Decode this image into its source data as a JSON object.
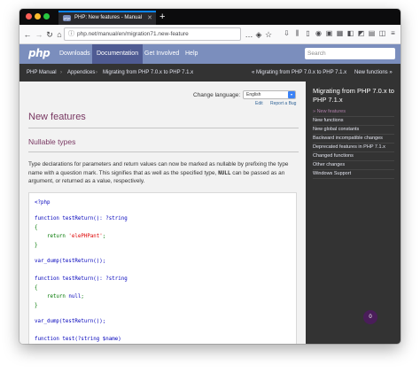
{
  "tab": {
    "title": "PHP: New features - Manual",
    "favicon_text": "php"
  },
  "nav": {
    "url": "php.net/manual/en/migration71.new-feature"
  },
  "site": {
    "logo": "php",
    "menu": [
      {
        "label": "Downloads",
        "active": false
      },
      {
        "label": "Documentation",
        "active": true
      },
      {
        "label": "Get Involved",
        "active": false
      },
      {
        "label": "Help",
        "active": false
      }
    ],
    "search_placeholder": "Search"
  },
  "breadcrumb": {
    "items": [
      "PHP Manual",
      "Appendices",
      "Migrating from PHP 7.0.x to PHP 7.1.x"
    ],
    "separator": "›",
    "prev": "« Migrating from PHP 7.0.x to PHP 7.1.x",
    "next": "New functions »"
  },
  "main": {
    "change_language_label": "Change language:",
    "language_value": "English",
    "edit_link": "Edit",
    "report_bug_link": "Report a Bug",
    "title": "New features",
    "section_title": "Nullable types",
    "para_before": "Type declarations for parameters and return values can now be marked as nullable by prefixing the type name with a question mark. This signifies that as well as the specified type,",
    "para_null": "NULL",
    "para_after": "can be passed as an argument, or returned as a value, respectively.",
    "code": {
      "l1": "<?php",
      "l2": "function testReturn(): ?string",
      "l3": "{",
      "l4a": "    return ",
      "l4b": "'elePHPant'",
      "l4c": ";",
      "l5": "}",
      "l6": "var_dump(testReturn());",
      "l7": "function testReturn(): ?string",
      "l8": "{",
      "l9a": "    return ",
      "l9b": "null",
      "l9c": ";",
      "l10": "}",
      "l11": "var_dump(testReturn());",
      "l12": "function test(?string $name)",
      "l13": "{"
    }
  },
  "sidebar": {
    "title": "Migrating from PHP 7.0.x to PHP 7.1.x",
    "items": [
      {
        "label": "» New features",
        "current": true
      },
      {
        "label": "New functions",
        "current": false
      },
      {
        "label": "New global constants",
        "current": false
      },
      {
        "label": "Backward incompatible changes",
        "current": false
      },
      {
        "label": "Deprecated features in PHP 7.1.x",
        "current": false
      },
      {
        "label": "Changed functions",
        "current": false
      },
      {
        "label": "Other changes",
        "current": false
      },
      {
        "label": "Windows Support",
        "current": false
      }
    ],
    "badge": "0"
  },
  "colors": {
    "php_header": "#7b8ebd",
    "php_menu_active": "#4f5b93",
    "heading": "#793862",
    "sidebar_bg": "#333333"
  }
}
